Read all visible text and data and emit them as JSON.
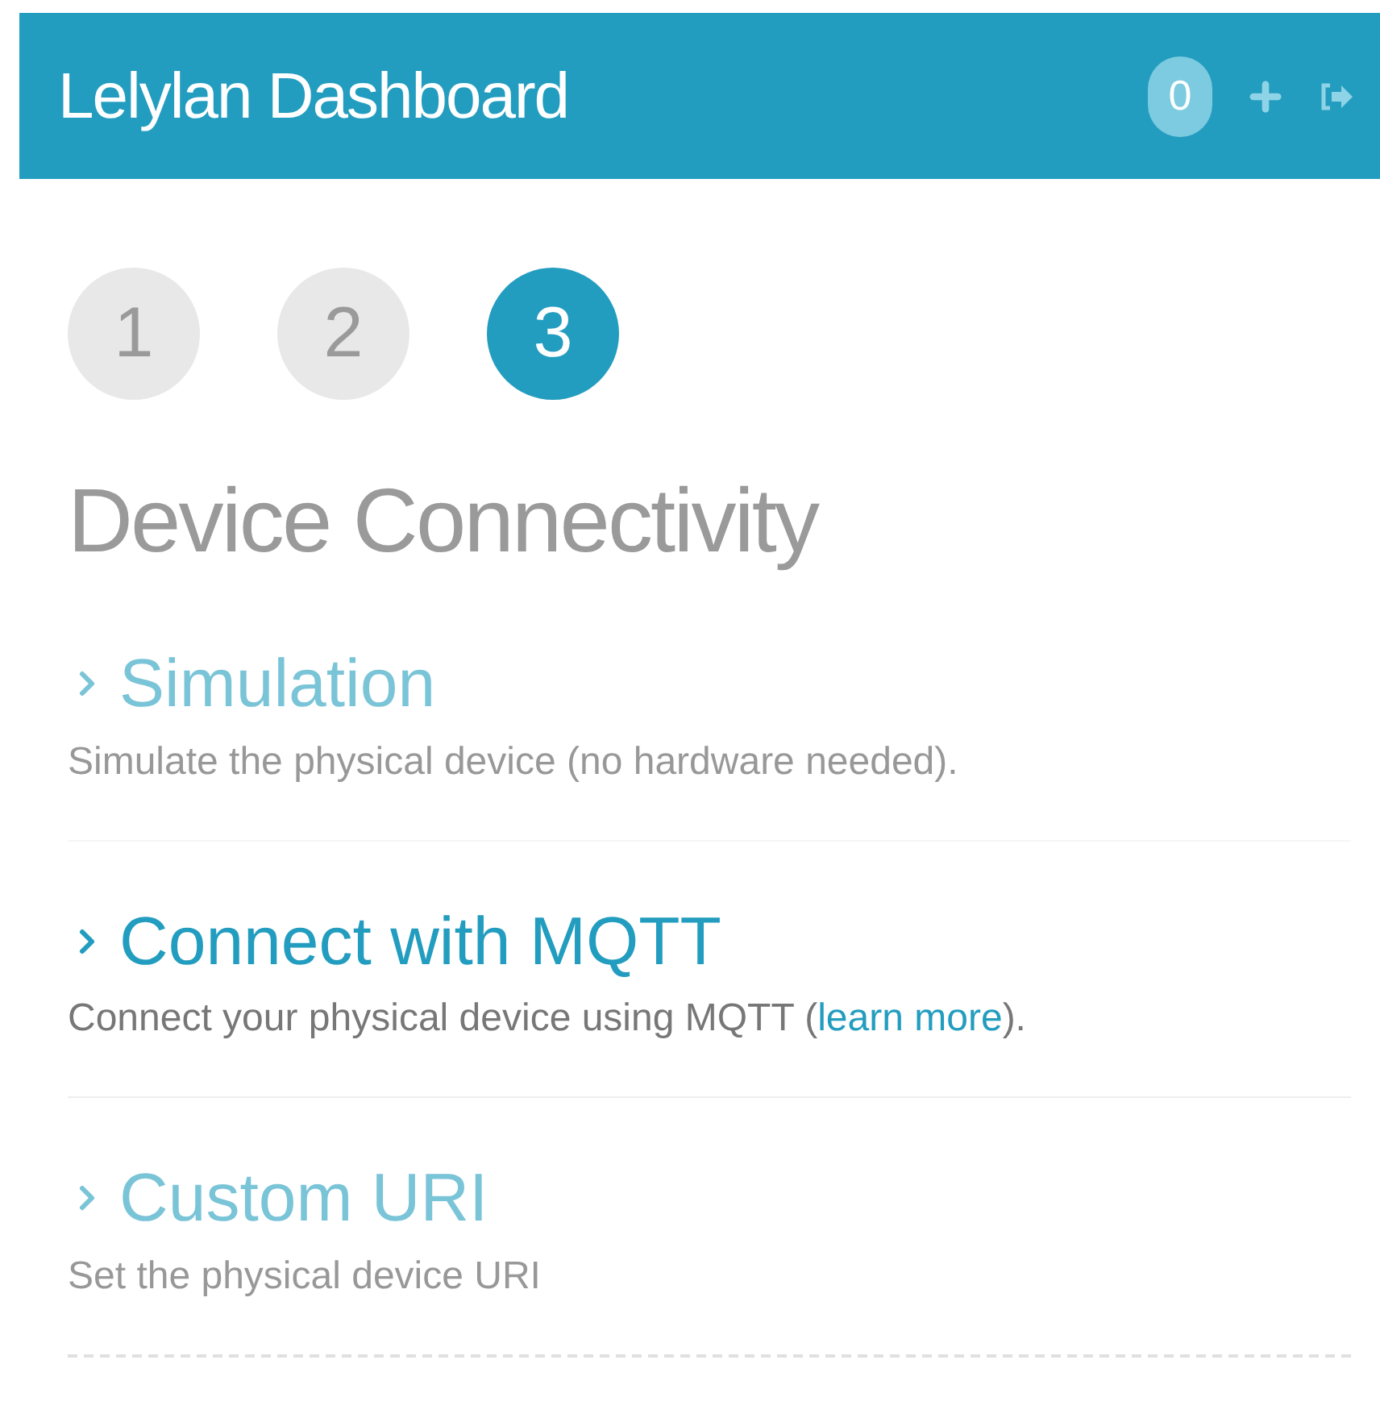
{
  "header": {
    "title": "Lelylan Dashboard",
    "badge": "0"
  },
  "steps": [
    {
      "label": "1",
      "selected": false
    },
    {
      "label": "2",
      "selected": false
    },
    {
      "label": "3",
      "selected": true
    }
  ],
  "heading": "Device Connectivity",
  "options": [
    {
      "title": "Simulation",
      "description": "Simulate the physical device (no hardware needed).",
      "selected": false
    },
    {
      "title": "Connect with MQTT",
      "description": "Connect your physical device using MQTT (",
      "link": "learn more",
      "description_end": ").",
      "selected": true
    },
    {
      "title": "Custom URI",
      "description": "Set the physical device URI",
      "selected": false
    }
  ]
}
